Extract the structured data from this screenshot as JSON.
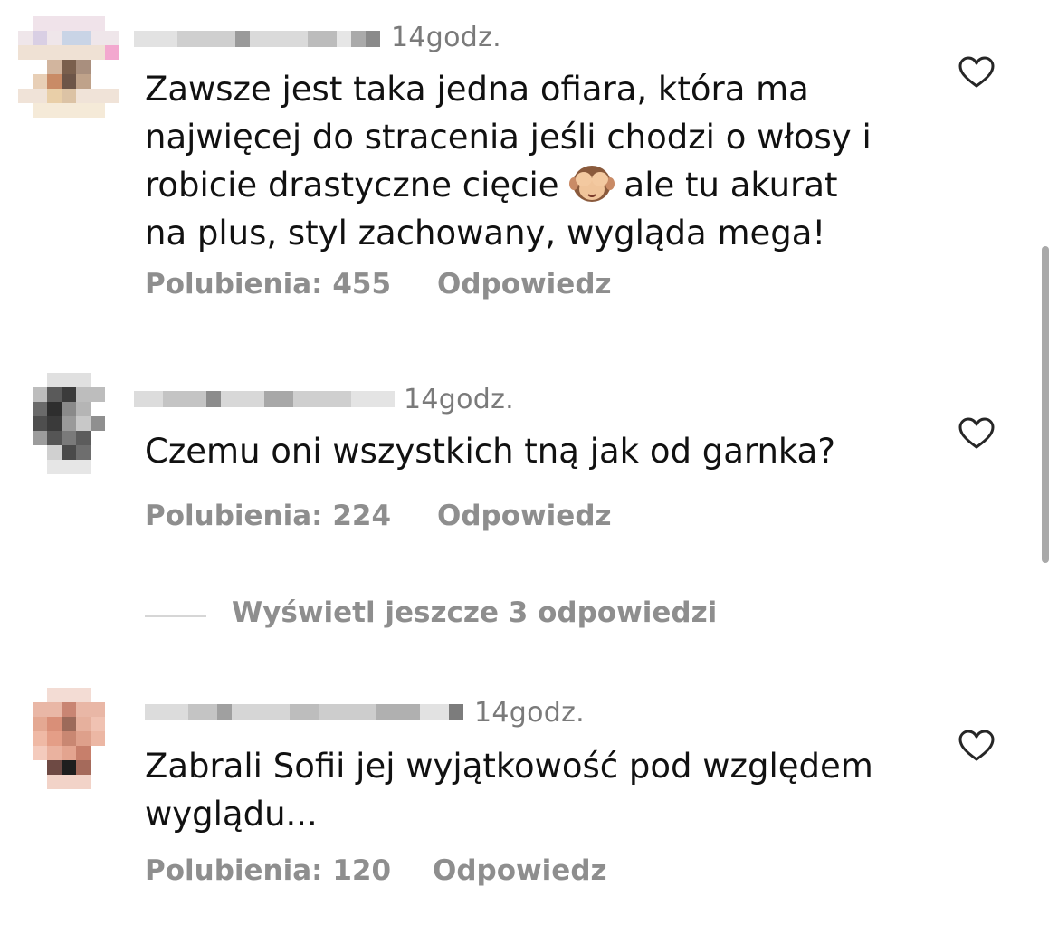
{
  "comments": [
    {
      "time": "14godz.",
      "text_before": "Zawsze jest taka jedna ofiara, która ma\nnajwięcej do stracenia jeśli chodzi o włosy i\nrobicie drastyczne cięcie",
      "emoji": "see-no-evil-monkey",
      "text_after": "ale tu akurat\nna plus, styl zachowany, wygląda mega!",
      "likes": "Polubienia: 455",
      "reply": "Odpowiedz"
    },
    {
      "time": "14godz.",
      "text_before": "Czemu oni wszystkich tną jak od garnka?",
      "text_after": "",
      "likes": "Polubienia: 224",
      "reply": "Odpowiedz"
    },
    {
      "time": "14godz.",
      "text_before": "Zabrali Sofii jej wyjątkowość pod względem\nwyglądu...",
      "text_after": "",
      "likes": "Polubienia: 120",
      "reply": "Odpowiedz"
    }
  ],
  "view_replies": "Wyświetl jeszcze 3 odpowiedzi",
  "icons": {
    "like": "heart-outline-icon"
  },
  "colors": {
    "text": "#111111",
    "muted": "#8e8e8e",
    "time": "#7a7a7a"
  }
}
